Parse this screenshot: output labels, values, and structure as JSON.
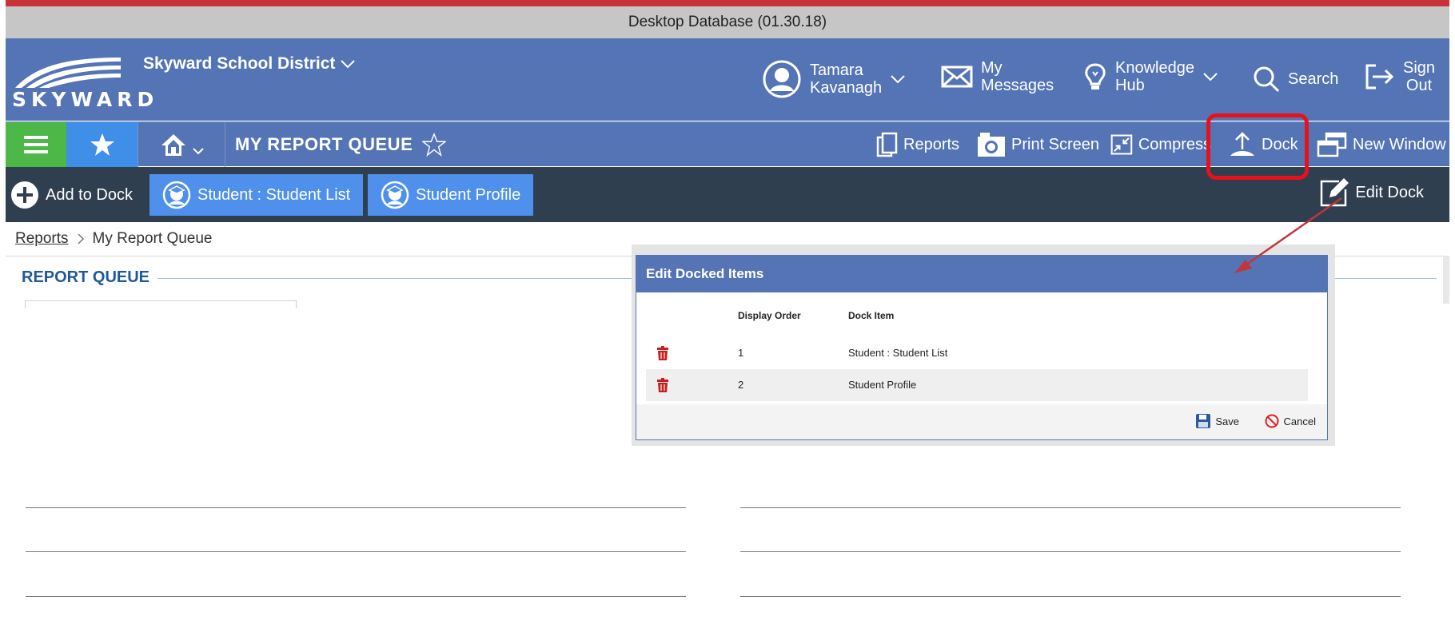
{
  "window": {
    "title": "Desktop Database (01.30.18)"
  },
  "header": {
    "logo_text": "SKYWARD",
    "district": "Skyward School District",
    "user_first": "Tamara",
    "user_last": "Kavanagh",
    "messages_1": "My",
    "messages_2": "Messages",
    "knowledge_1": "Knowledge",
    "knowledge_2": "Hub",
    "search": "Search",
    "signout_1": "Sign",
    "signout_2": "Out"
  },
  "toolbar": {
    "page_title": "MY REPORT QUEUE",
    "reports": "Reports",
    "print_screen": "Print Screen",
    "compress": "Compress",
    "dock": "Dock",
    "new_window": "New Window"
  },
  "dockbar": {
    "add_to_dock": "Add to Dock",
    "items": [
      "Student : Student List",
      "Student Profile"
    ],
    "edit_dock": "Edit Dock"
  },
  "breadcrumb": {
    "parent": "Reports",
    "current": "My Report Queue"
  },
  "section": {
    "title": "REPORT QUEUE"
  },
  "dialog": {
    "title": "Edit Docked Items",
    "col_order": "Display Order",
    "col_item": "Dock Item",
    "rows": [
      {
        "order": "1",
        "item": "Student : Student List"
      },
      {
        "order": "2",
        "item": "Student Profile"
      }
    ],
    "save": "Save",
    "cancel": "Cancel"
  },
  "colors": {
    "header_blue": "#5474b5",
    "menu_green": "#4db848",
    "fav_blue": "#3f8ee8",
    "dockbar_dark": "#2f3f4f",
    "dock_item_blue": "#4e90ec",
    "highlight_red": "#e8111b",
    "trash_red": "#c81e1e"
  }
}
